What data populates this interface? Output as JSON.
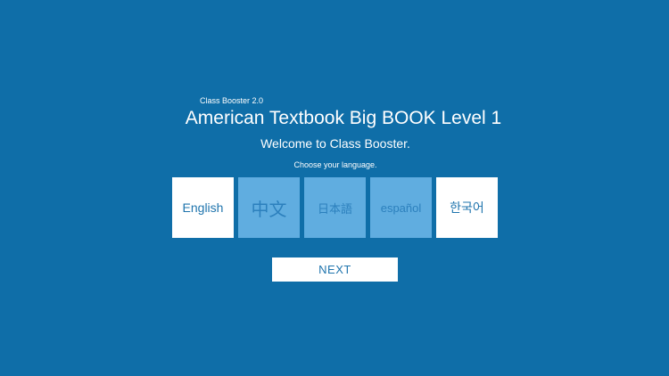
{
  "header": {
    "version_label": "Class Booster 2.0",
    "title": "American Textbook Big BOOK Level 1",
    "welcome": "Welcome to Class Booster.",
    "prompt": "Choose your language."
  },
  "languages": [
    {
      "label": "English",
      "selected": true
    },
    {
      "label": "中文",
      "selected": false
    },
    {
      "label": "日本語",
      "selected": false
    },
    {
      "label": "español",
      "selected": false
    },
    {
      "label": "한국어",
      "selected": true
    }
  ],
  "actions": {
    "next_label": "NEXT"
  },
  "colors": {
    "background": "#0f6ea8",
    "tile_selected": "#ffffff",
    "tile_unselected": "#60ade0",
    "accent_text": "#1f74ad"
  }
}
